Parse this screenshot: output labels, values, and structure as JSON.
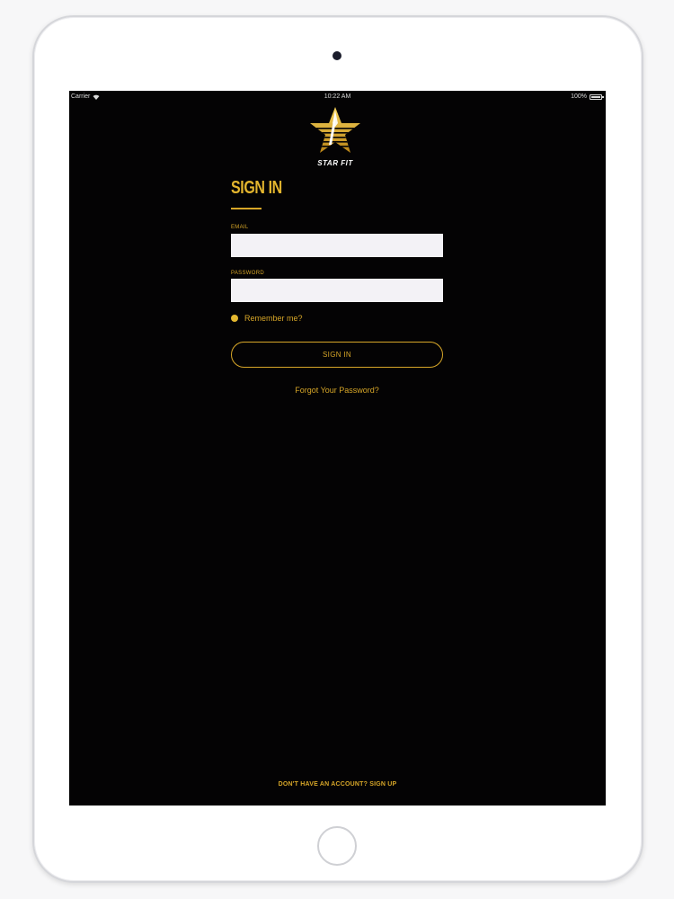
{
  "status_bar": {
    "carrier": "Carrier",
    "time": "10:22 AM",
    "battery": "100%"
  },
  "brand": {
    "name": "STAR FIT",
    "accent_color": "#d7a628"
  },
  "form": {
    "title": "SIGN IN",
    "email_label": "EMAIL",
    "email_value": "",
    "password_label": "PASSWORD",
    "password_value": "",
    "remember_label": "Remember me?",
    "remember_checked": true,
    "submit_label": "SIGN IN",
    "forgot_label": "Forgot Your Password?"
  },
  "footer": {
    "signup_label": "DON'T HAVE AN ACCOUNT? SIGN UP"
  },
  "icons": [
    "wifi-icon",
    "battery-icon",
    "star-logo-icon",
    "radio-icon"
  ]
}
